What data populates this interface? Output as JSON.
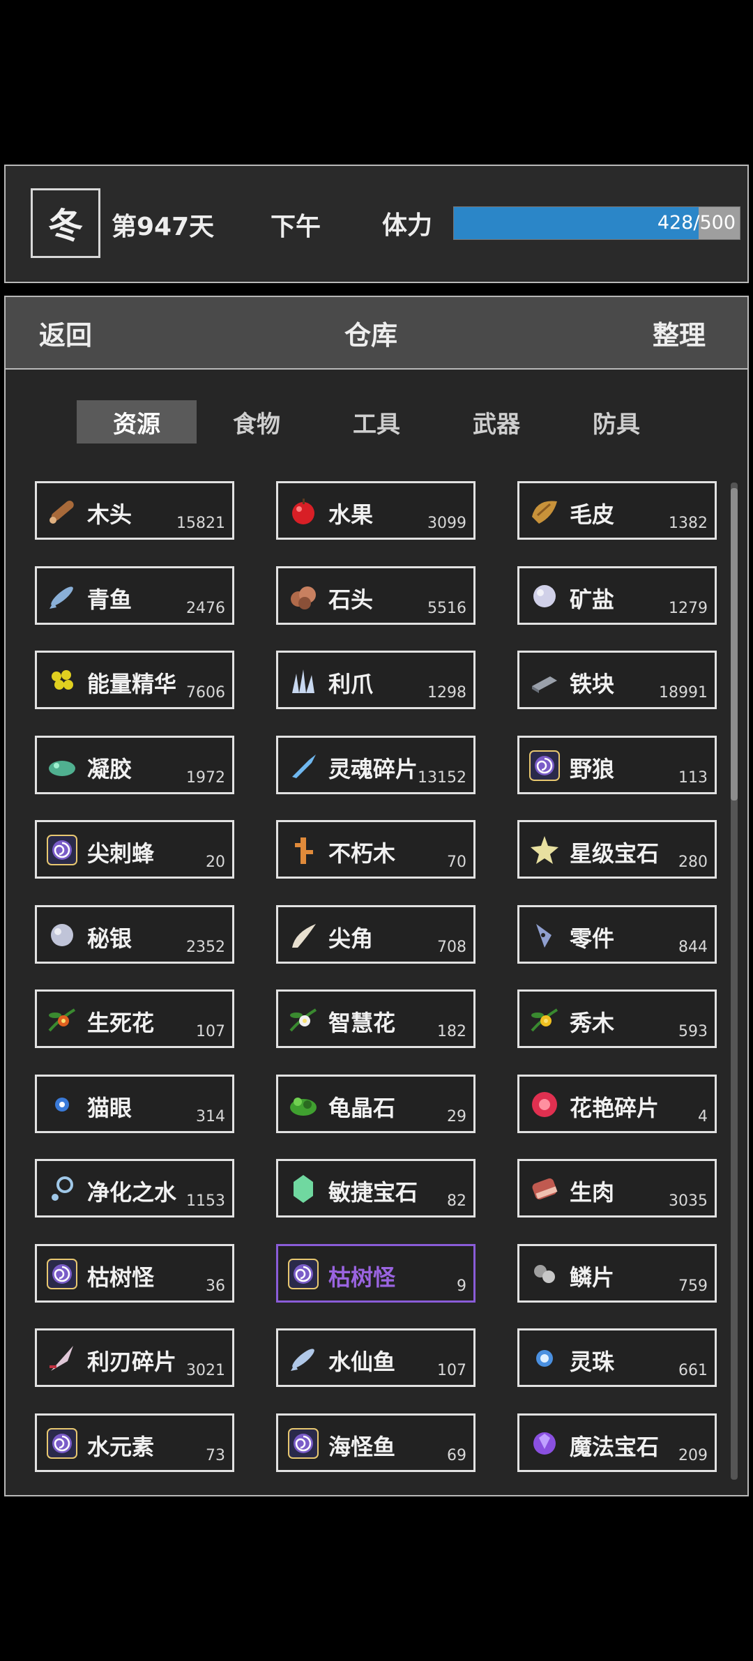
{
  "status": {
    "season": "冬",
    "day": "第947天",
    "time_of_day": "下午",
    "stamina_label": "体力",
    "stamina_current": 428,
    "stamina_max": 500,
    "stamina_text": "428/500"
  },
  "topbar": {
    "back_label": "返回",
    "title": "仓库",
    "sort_label": "整理"
  },
  "tabs": [
    {
      "label": "资源",
      "active": true
    },
    {
      "label": "食物",
      "active": false
    },
    {
      "label": "工具",
      "active": false
    },
    {
      "label": "武器",
      "active": false
    },
    {
      "label": "防具",
      "active": false
    }
  ],
  "items": [
    {
      "name": "木头",
      "count": "15821",
      "icon": "wood-icon",
      "color": "#a86a3a"
    },
    {
      "name": "水果",
      "count": "3099",
      "icon": "apple-icon",
      "color": "#d81f26"
    },
    {
      "name": "毛皮",
      "count": "1382",
      "icon": "fur-icon",
      "color": "#c8923a"
    },
    {
      "name": "青鱼",
      "count": "2476",
      "icon": "fish-icon",
      "color": "#8ab0d8"
    },
    {
      "name": "石头",
      "count": "5516",
      "icon": "stone-icon",
      "color": "#b06a4a"
    },
    {
      "name": "矿盐",
      "count": "1279",
      "icon": "salt-icon",
      "color": "#d0d0e8"
    },
    {
      "name": "能量精华",
      "count": "7606",
      "icon": "energy-icon",
      "color": "#e0d020"
    },
    {
      "name": "利爪",
      "count": "1298",
      "icon": "claw-icon",
      "color": "#c8d8f0"
    },
    {
      "name": "铁块",
      "count": "18991",
      "icon": "iron-icon",
      "color": "#9aa0aa"
    },
    {
      "name": "凝胶",
      "count": "1972",
      "icon": "gel-icon",
      "color": "#50b090"
    },
    {
      "name": "灵魂碎片",
      "count": "13152",
      "icon": "soul-icon",
      "color": "#70b8f0"
    },
    {
      "name": "野狼",
      "count": "113",
      "icon": "vortex-icon",
      "color": "#7a5cc8"
    },
    {
      "name": "尖刺蜂",
      "count": "20",
      "icon": "vortex-icon",
      "color": "#7a5cc8"
    },
    {
      "name": "不朽木",
      "count": "70",
      "icon": "branch-icon",
      "color": "#e08a3a"
    },
    {
      "name": "星级宝石",
      "count": "280",
      "icon": "star-gem-icon",
      "color": "#e8e0a0"
    },
    {
      "name": "秘银",
      "count": "2352",
      "icon": "mithril-icon",
      "color": "#c0c4d8"
    },
    {
      "name": "尖角",
      "count": "708",
      "icon": "horn-icon",
      "color": "#e8e0d0"
    },
    {
      "name": "零件",
      "count": "844",
      "icon": "part-icon",
      "color": "#90a0d0"
    },
    {
      "name": "生死花",
      "count": "107",
      "icon": "flower-red-icon",
      "color": "#e06020"
    },
    {
      "name": "智慧花",
      "count": "182",
      "icon": "flower-white-icon",
      "color": "#f0f0f0"
    },
    {
      "name": "秀木",
      "count": "593",
      "icon": "flower-yellow-icon",
      "color": "#f0c020"
    },
    {
      "name": "猫眼",
      "count": "314",
      "icon": "cat-eye-icon",
      "color": "#3a7ad8"
    },
    {
      "name": "龟晶石",
      "count": "29",
      "icon": "turtle-crystal-icon",
      "color": "#40a030"
    },
    {
      "name": "花艳碎片",
      "count": "4",
      "icon": "petal-icon",
      "color": "#e03050"
    },
    {
      "name": "净化之水",
      "count": "1153",
      "icon": "water-orb-icon",
      "color": "#a0c8e8"
    },
    {
      "name": "敏捷宝石",
      "count": "82",
      "icon": "emerald-icon",
      "color": "#70d8a0"
    },
    {
      "name": "生肉",
      "count": "3035",
      "icon": "meat-icon",
      "color": "#c05a50"
    },
    {
      "name": "枯树怪",
      "count": "36",
      "icon": "vortex-icon",
      "color": "#7a5cc8"
    },
    {
      "name": "枯树怪",
      "count": "9",
      "icon": "vortex-icon",
      "color": "#7a5cc8",
      "selected": true
    },
    {
      "name": "鳞片",
      "count": "759",
      "icon": "scale-icon",
      "color": "#a0a0a0"
    },
    {
      "name": "利刃碎片",
      "count": "3021",
      "icon": "blade-icon",
      "color": "#e0c8d8"
    },
    {
      "name": "水仙鱼",
      "count": "107",
      "icon": "small-fish-icon",
      "color": "#b0c8e8"
    },
    {
      "name": "灵珠",
      "count": "661",
      "icon": "spirit-orb-icon",
      "color": "#4a90e0"
    },
    {
      "name": "水元素",
      "count": "73",
      "icon": "vortex-icon",
      "color": "#7a5cc8"
    },
    {
      "name": "海怪鱼",
      "count": "69",
      "icon": "vortex-icon",
      "color": "#7a5cc8"
    },
    {
      "name": "魔法宝石",
      "count": "209",
      "icon": "magic-gem-icon",
      "color": "#8a50e0"
    }
  ]
}
